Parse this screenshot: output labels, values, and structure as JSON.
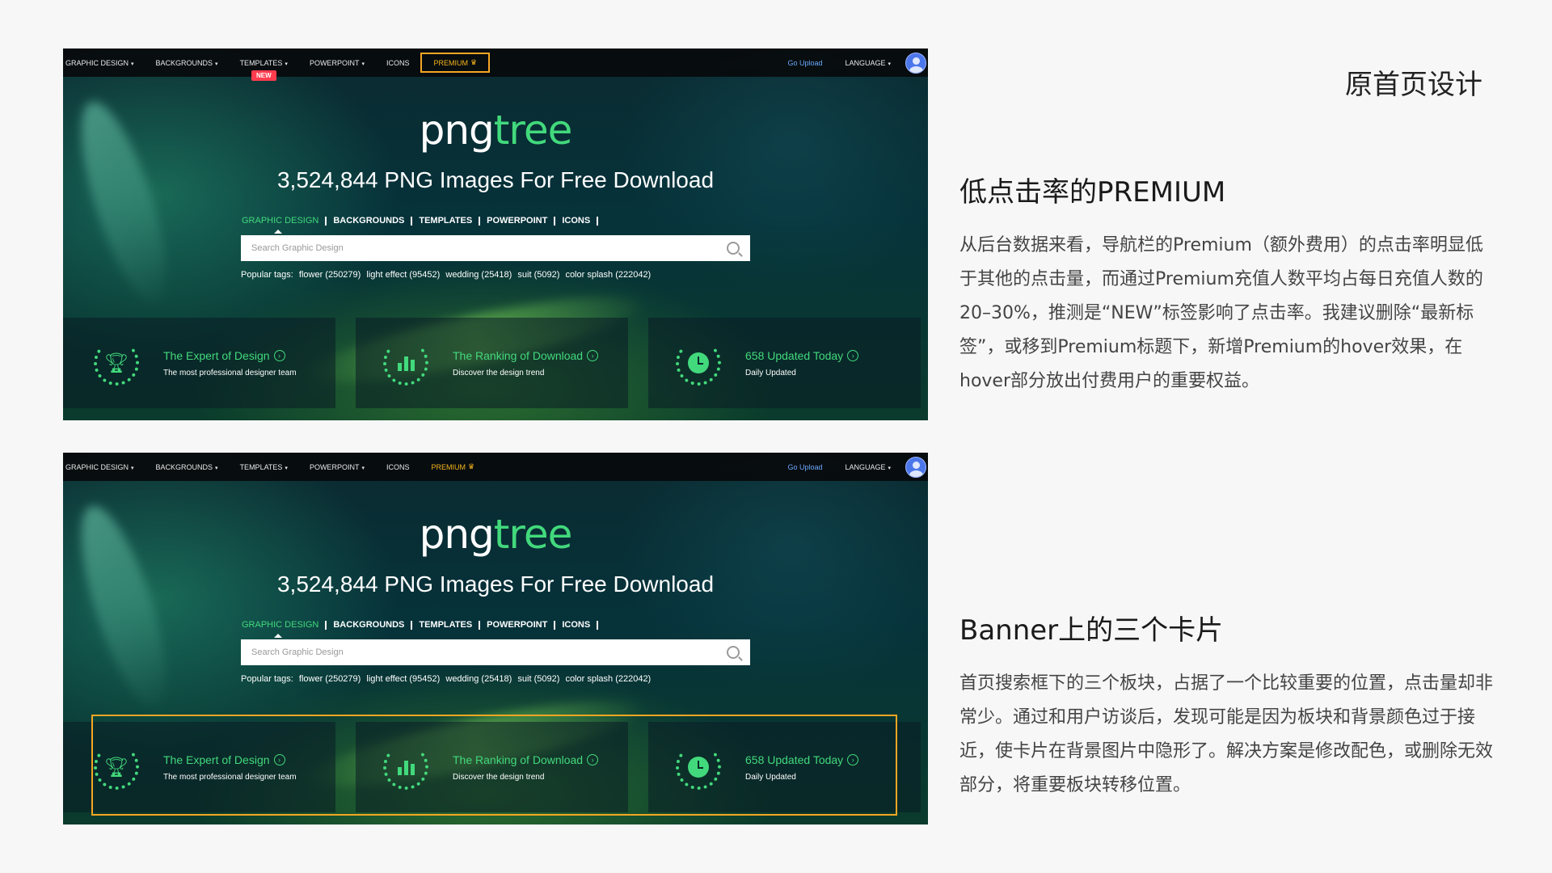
{
  "page": {
    "section_title": "原首页设计"
  },
  "nav": {
    "graphic_design": "GRAPHIC DESIGN",
    "backgrounds": "BACKGROUNDS",
    "templates": "TEMPLATES",
    "powerpoint": "POWERPOINT",
    "icons": "ICONS",
    "premium": "PREMIUM",
    "new_badge": "NEW",
    "go_upload": "Go Upload",
    "language": "LANGUAGE",
    "caret": "▾",
    "crown": "♛"
  },
  "banner": {
    "logo_png": "png",
    "logo_tree": "tree",
    "headline": "3,524,844 PNG Images For Free Download",
    "categories": [
      "GRAPHIC DESIGN",
      "BACKGROUNDS",
      "TEMPLATES",
      "POWERPOINT",
      "ICONS"
    ],
    "search_placeholder": "Search Graphic Design",
    "popular_label": "Popular tags:",
    "tags": [
      "flower (250279)",
      "light effect (95452)",
      "wedding (25418)",
      "suit (5092)",
      "color splash (222042)"
    ]
  },
  "cards": [
    {
      "title": "The Expert of Design",
      "subtitle": "The most professional designer team",
      "icon": "trophy-icon"
    },
    {
      "title": "The Ranking of Download",
      "subtitle": "Discover the design trend",
      "icon": "bar-chart-icon"
    },
    {
      "title": "658 Updated Today",
      "subtitle": "Daily Updated",
      "icon": "clock-icon"
    }
  ],
  "notes": {
    "premium_heading": "低点击率的PREMIUM",
    "premium_body": "从后台数据来看，导航栏的Premium（额外费用）的点击率明显低于其他的点击量，而通过Premium充值人数平均占每日充值人数的20–30%，推测是“NEW”标签影响了点击率。我建议删除“最新标签”，或移到Premium标题下，新增Premium的hover效果，在hover部分放出付费用户的重要权益。",
    "cards_heading": "Banner上的三个卡片",
    "cards_body": "首页搜索框下的三个板块，占据了一个比较重要的位置，点击量却非常少。通过和用户访谈后，发现可能是因为板块和背景颜色过于接近，使卡片在背景图片中隐形了。解决方案是修改配色，或删除无效部分，将重要板块转移位置。"
  },
  "colors": {
    "accent_green": "#42d97c",
    "premium_gold": "#f5b51d",
    "highlight_orange": "#f5a623",
    "new_red": "#ff3b4e"
  }
}
